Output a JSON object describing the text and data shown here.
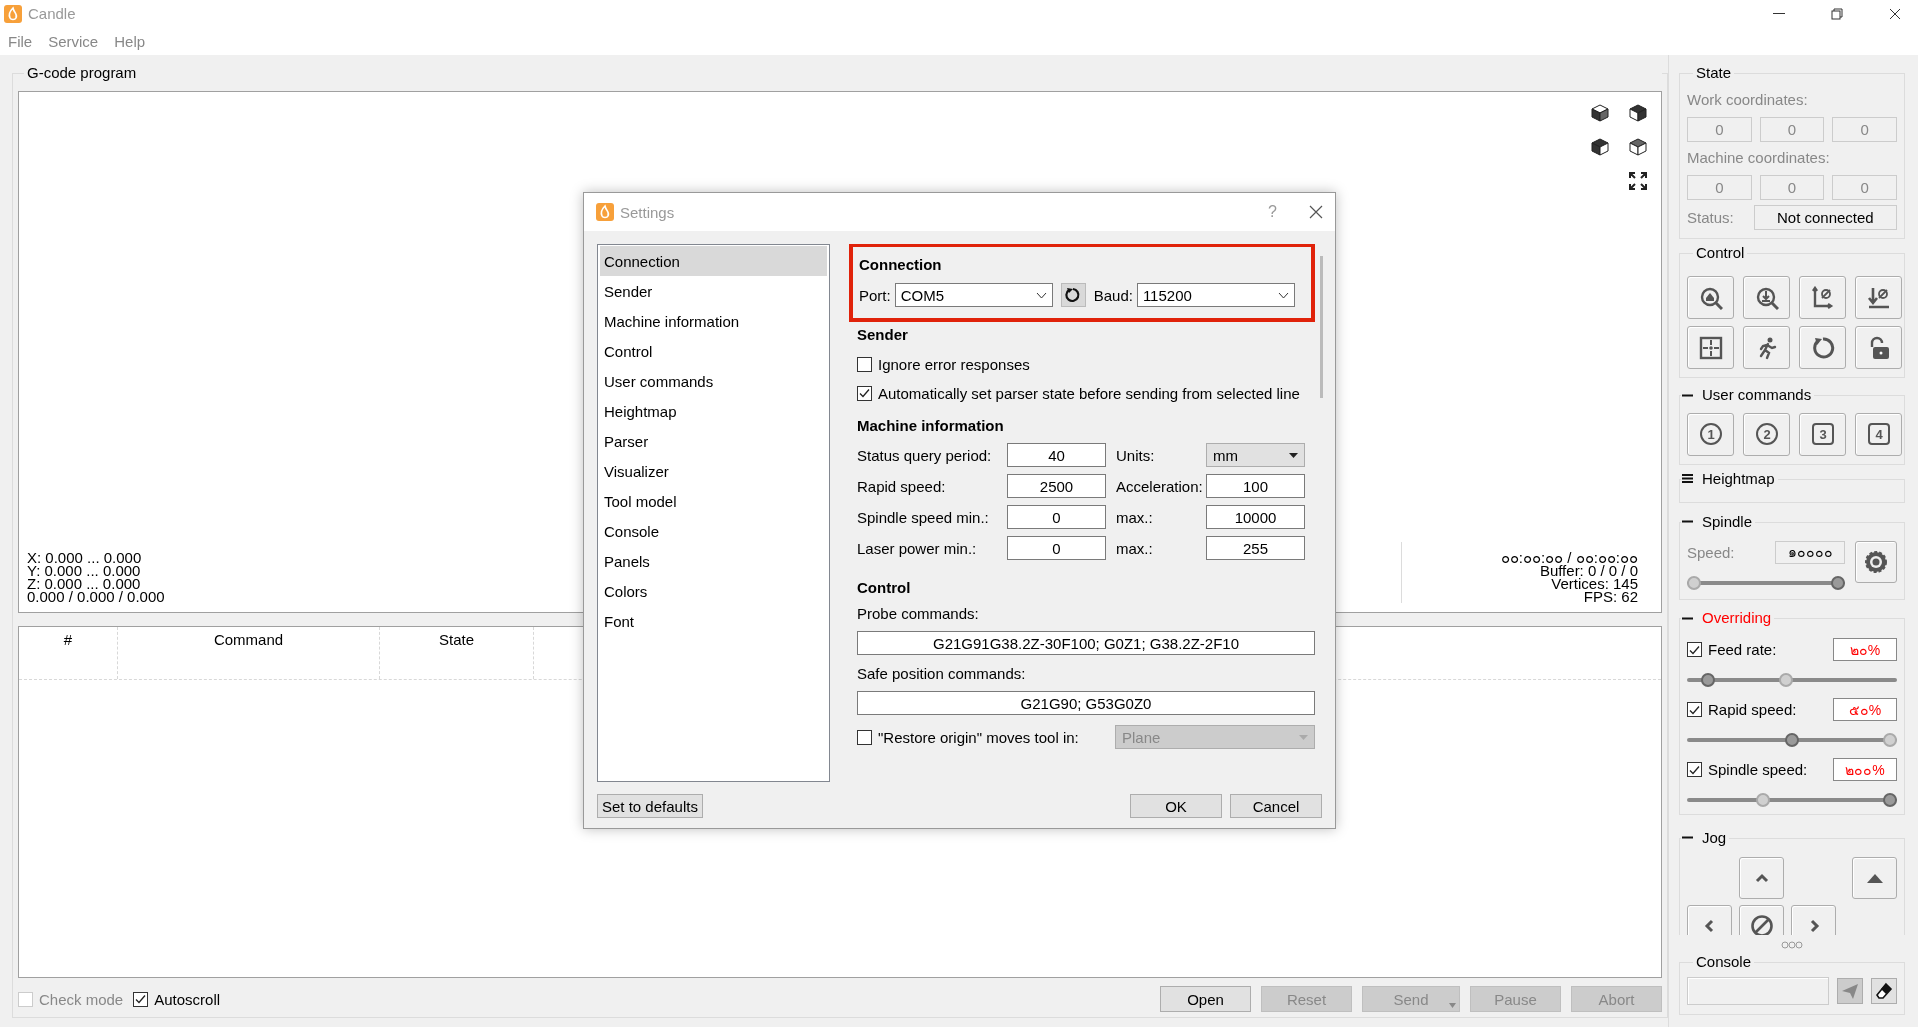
{
  "window": {
    "title": "Candle"
  },
  "menu": [
    {
      "label": "File"
    },
    {
      "label": "Service"
    },
    {
      "label": "Help"
    }
  ],
  "gcode_program": {
    "title": "G-code program",
    "bounds": [
      "X: 0.000 ... 0.000",
      "Y: 0.000 ... 0.000",
      "Z: 0.000 ... 0.000",
      "0.000 / 0.000 / 0.000"
    ],
    "stats": [
      "๐๐:๐๐:๐๐ / ๐๐:๐๐:๐๐",
      "Buffer: 0 / 0 / 0",
      "Vertices: 145",
      "FPS: 62"
    ],
    "columns": [
      "#",
      "Command",
      "State"
    ],
    "check_mode": {
      "label": "Check mode",
      "checked": false,
      "disabled": true
    },
    "autoscroll": {
      "label": "Autoscroll",
      "checked": true,
      "disabled": false
    },
    "buttons": [
      {
        "label": "Open",
        "disabled": false,
        "kind": "plain"
      },
      {
        "label": "Reset",
        "disabled": true,
        "kind": "plain"
      },
      {
        "label": "Send",
        "disabled": true,
        "kind": "menu"
      },
      {
        "label": "Pause",
        "disabled": true,
        "kind": "plain"
      },
      {
        "label": "Abort",
        "disabled": true,
        "kind": "plain"
      }
    ]
  },
  "state": {
    "title": "State",
    "work_label": "Work coordinates:",
    "work": [
      "0",
      "0",
      "0"
    ],
    "machine_label": "Machine coordinates:",
    "machine": [
      "0",
      "0",
      "0"
    ],
    "status_label": "Status:",
    "status": "Not connected"
  },
  "control": {
    "title": "Control"
  },
  "user_commands": {
    "title": "User commands",
    "expanded": true,
    "buttons": [
      {
        "label": "1",
        "kind": "circle"
      },
      {
        "label": "2",
        "kind": "circle"
      },
      {
        "label": "3",
        "kind": "square"
      },
      {
        "label": "4",
        "kind": "square"
      }
    ]
  },
  "heightmap": {
    "title": "Heightmap",
    "expanded": false
  },
  "spindle": {
    "title": "Spindle",
    "expanded": true,
    "speed_label": "Speed:",
    "speed": "๑๐๐๐๐",
    "thumbs": [
      {
        "kind": "indicator",
        "level": 0
      },
      {
        "kind": "handle",
        "level": 1
      }
    ]
  },
  "overriding": {
    "title": "Overriding",
    "expanded": true,
    "active": true,
    "items": [
      {
        "label": "Feed rate:",
        "checked": true,
        "value": "๒๐%",
        "thumbs": [
          {
            "kind": "handle",
            "level": 0.07
          },
          {
            "kind": "indicator",
            "level": 0.47
          }
        ]
      },
      {
        "label": "Rapid speed:",
        "checked": true,
        "value": "๕๐%",
        "thumbs": [
          {
            "kind": "handle",
            "level": 0.5
          },
          {
            "kind": "indicator",
            "level": 1
          }
        ]
      },
      {
        "label": "Spindle speed:",
        "checked": true,
        "value": "๒๐๐%",
        "thumbs": [
          {
            "kind": "indicator",
            "level": 0.35
          },
          {
            "kind": "handle",
            "level": 1
          }
        ]
      }
    ]
  },
  "jog": {
    "title": "Jog",
    "expanded": true
  },
  "console": {
    "title": "Console"
  },
  "dialog": {
    "title": "Settings",
    "help": "?",
    "nav": [
      {
        "label": "Connection",
        "selected": true
      },
      {
        "label": "Sender",
        "selected": false
      },
      {
        "label": "Machine information",
        "selected": false
      },
      {
        "label": "Control",
        "selected": false
      },
      {
        "label": "User commands",
        "selected": false
      },
      {
        "label": "Heightmap",
        "selected": false
      },
      {
        "label": "Parser",
        "selected": false
      },
      {
        "label": "Visualizer",
        "selected": false
      },
      {
        "label": "Tool model",
        "selected": false
      },
      {
        "label": "Console",
        "selected": false
      },
      {
        "label": "Panels",
        "selected": false
      },
      {
        "label": "Colors",
        "selected": false
      },
      {
        "label": "Font",
        "selected": false
      }
    ],
    "connection": {
      "title": "Connection",
      "highlighted": true,
      "port_label": "Port:",
      "port": "COM5",
      "baud_label": "Baud:",
      "baud": "115200"
    },
    "sender": {
      "title": "Sender",
      "options": [
        {
          "label": "Ignore error responses",
          "checked": false
        },
        {
          "label": "Automatically set parser state before sending from selected line",
          "checked": true
        }
      ]
    },
    "machine": {
      "title": "Machine information",
      "fields": [
        {
          "label": "Status query period:",
          "value": "40",
          "kind": "spin"
        },
        {
          "label": "Units:",
          "value": "mm",
          "kind": "dropdown"
        },
        {
          "label": "Rapid speed:",
          "value": "2500",
          "kind": "spin"
        },
        {
          "label": "Acceleration:",
          "value": "100",
          "kind": "spin"
        },
        {
          "label": "Spindle speed min.:",
          "value": "0",
          "kind": "spin"
        },
        {
          "label": "max.:",
          "value": "10000",
          "kind": "spin"
        },
        {
          "label": "Laser power min.:",
          "value": "0",
          "kind": "spin"
        },
        {
          "label": "max.:",
          "value": "255",
          "kind": "spin"
        }
      ]
    },
    "control": {
      "title": "Control",
      "probe_label": "Probe commands:",
      "probe": "G21G91G38.2Z-30F100; G0Z1; G38.2Z-2F10",
      "safe_label": "Safe position commands:",
      "safe": "G21G90; G53G0Z0",
      "restore": {
        "label": "\"Restore origin\" moves tool in:",
        "checked": false
      },
      "restore_mode": {
        "value": "Plane",
        "disabled": true
      }
    },
    "set_defaults": "Set to defaults",
    "ok": "OK",
    "cancel": "Cancel"
  }
}
